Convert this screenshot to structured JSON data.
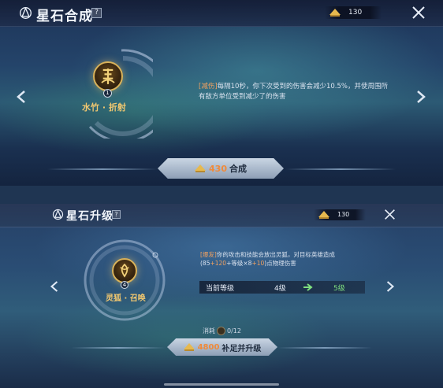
{
  "top_panel": {
    "title": "星石合成",
    "help_label": "?",
    "currency_amount": "130",
    "stone": {
      "name": "水竹 · 折射",
      "level": "1",
      "icon": "bamboo-stone-icon"
    },
    "description": {
      "tag": "[减伤]",
      "text": "每隔10秒，你下次受到的伤害会减少10.5%，并使周围所有敌方单位受到减少了的伤害"
    },
    "craft_button": {
      "cost": "430",
      "label": "合成"
    }
  },
  "bottom_panel": {
    "title": "星石升级",
    "help_label": "?",
    "currency_amount": "130",
    "stone": {
      "name": "灵狐 · 召唤",
      "level": "4",
      "icon": "fox-stone-icon"
    },
    "description": {
      "tag": "[爆发]",
      "line1": "你的攻击和技能会放出灵狐，对目标英雄造成",
      "formula_open": "(85",
      "formula_a": "+120",
      "formula_b": "+等级×8",
      "formula_c": "+10",
      "formula_close": ")点物理伤害"
    },
    "level_row": {
      "label": "当前等级",
      "current": "4级",
      "next": "5级"
    },
    "consume": {
      "label": "消耗",
      "value": "0/12"
    },
    "upgrade_button": {
      "cost": "4800",
      "label": "补足并升级"
    }
  },
  "colors": {
    "accent_gold": "#f2c870",
    "cost_orange": "#f08a3a",
    "highlight_orange": "#f0a060",
    "green": "#7fe07f"
  }
}
